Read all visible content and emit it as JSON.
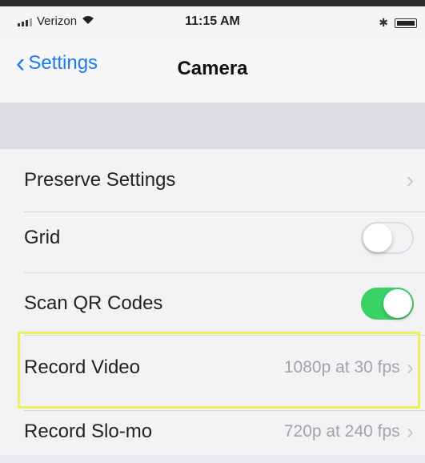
{
  "status_bar": {
    "carrier": "Verizon",
    "time": "11:15 AM",
    "bluetooth_symbol": "✱",
    "icons": [
      "signal-icon",
      "wifi-icon",
      "bluetooth-icon",
      "battery-icon"
    ]
  },
  "nav": {
    "back_label": "Settings",
    "title": "Camera"
  },
  "rows": [
    {
      "label": "Preserve Settings",
      "type": "disclosure"
    },
    {
      "label": "Grid",
      "type": "toggle",
      "on": false
    },
    {
      "label": "Scan QR Codes",
      "type": "toggle",
      "on": true
    },
    {
      "label": "Record Video",
      "type": "disclosure",
      "value": "1080p at 30 fps",
      "highlighted": true
    },
    {
      "label": "Record Slo-mo",
      "type": "disclosure",
      "value": "720p at 240 fps"
    }
  ],
  "colors": {
    "accent": "#1a7cf0",
    "toggle_on": "#3ad165",
    "highlight": "#eef05a"
  }
}
